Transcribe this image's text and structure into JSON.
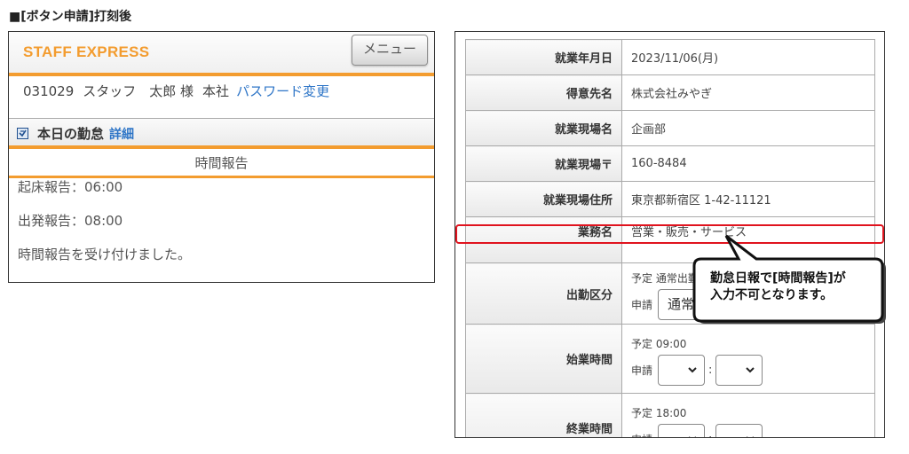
{
  "section_title": "■[ボタン申請]打刻後",
  "mobile": {
    "brand": "STAFF EXPRESS",
    "menu_button": "メニュー",
    "user": {
      "code": "031029",
      "name": "スタッフ　太郎 様",
      "office": "本社",
      "password_link": "パスワード変更"
    },
    "attendance": {
      "title": "本日の勤怠",
      "detail_link": "詳細"
    },
    "report_header": "時間報告",
    "report_lines": [
      "起床報告：06:00",
      "出発報告：08:00",
      "時間報告を受け付けました。"
    ]
  },
  "form": {
    "rows": [
      {
        "label": "就業年月日",
        "value": "2023/11/06(月)"
      },
      {
        "label": "得意先名",
        "value": "株式会社みやぎ"
      },
      {
        "label": "就業現場名",
        "value": "企画部"
      },
      {
        "label": "就業現場〒",
        "value": "160-8484"
      },
      {
        "label": "就業現場住所",
        "value": "東京都新宿区 1-42-11121"
      },
      {
        "label": "業務名",
        "value": "営業・販売・サービス"
      }
    ],
    "attendance_type": {
      "label": "出勤区分",
      "plan": "予定 通常出勤",
      "apply_label": "申請",
      "selected": "通常"
    },
    "start_time": {
      "label": "始業時間",
      "plan": "予定 09:00",
      "apply_label": "申請",
      "colon": ":"
    },
    "end_time": {
      "label": "終業時間",
      "plan": "予定 18:00",
      "apply_label": "申請",
      "colon": ":"
    }
  },
  "callout": {
    "line1": "勤怠日報で[時間報告]が",
    "line2": "入力不可となります。"
  },
  "colors": {
    "accent_orange": "#f39c2f",
    "link_blue": "#2e75c7",
    "highlight_red": "#e0131e"
  }
}
